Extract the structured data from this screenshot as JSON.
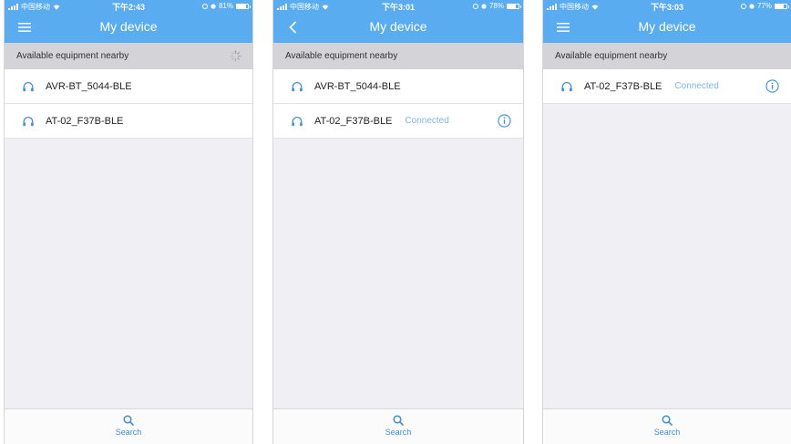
{
  "phones": [
    {
      "status": {
        "carrier": "中国移动",
        "time": "下午2:43",
        "battery": "81%",
        "battery_level": 0.81
      },
      "nav": {
        "title": "My device",
        "left_icon": "menu-icon"
      },
      "section_header": "Available equipment nearby",
      "devices": [
        {
          "name": "AVR-BT_5044-BLE",
          "status": ""
        },
        {
          "name": "AT-02_F37B-BLE",
          "status": ""
        }
      ],
      "tab": {
        "label": "Search",
        "icon": "search-icon"
      }
    },
    {
      "status": {
        "carrier": "中国移动",
        "time": "下午3:01",
        "battery": "78%",
        "battery_level": 0.78
      },
      "nav": {
        "title": "My device",
        "left_icon": "back-icon"
      },
      "section_header": "Available equipment nearby",
      "devices": [
        {
          "name": "AVR-BT_5044-BLE",
          "status": ""
        },
        {
          "name": "AT-02_F37B-BLE",
          "status": "Connected"
        }
      ],
      "tab": {
        "label": "Search",
        "icon": "search-icon"
      }
    },
    {
      "status": {
        "carrier": "中国移动",
        "time": "下午3:03",
        "battery": "77%",
        "battery_level": 0.77
      },
      "nav": {
        "title": "My device",
        "left_icon": "menu-icon"
      },
      "section_header": "Available equipment nearby",
      "devices": [
        {
          "name": "AT-02_F37B-BLE",
          "status": "Connected"
        }
      ],
      "tab": {
        "label": "Search",
        "icon": "search-icon"
      }
    }
  ],
  "colors": {
    "accent": "#5aacf0",
    "connected": "#7fb6e6",
    "header_bg": "#d3d3d8",
    "page_bg": "#efeff4"
  }
}
